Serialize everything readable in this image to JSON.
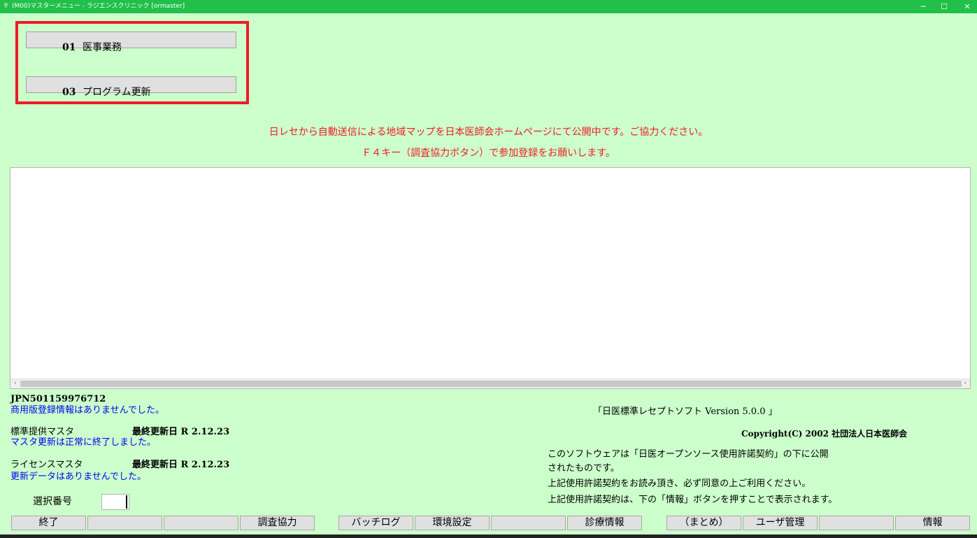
{
  "window": {
    "title": "(M00)マスターメニュー - ラジエンスクリニック [ormaster]",
    "app_icon": "app-icon",
    "min_glyph": "─",
    "max_glyph": "☐",
    "close_glyph": "✕"
  },
  "menu": {
    "items": [
      {
        "number": "01",
        "label": "医事業務"
      },
      {
        "number": "03",
        "label": "プログラム更新"
      }
    ]
  },
  "notice": {
    "line1": "日レセから自動送信による地域マップを日本医師会ホームページにて公開中です。ご協力ください。",
    "line2": "Ｆ４キー（調査協力ボタン）で参加登録をお願いします。"
  },
  "log": {
    "scroll_left": "‹",
    "scroll_right": "›"
  },
  "info": {
    "jpn_id": "JPN501159976712",
    "commercial_status": "商用版登録情報はありませんでした。",
    "std_master_label": "標準提供マスタ",
    "std_master_date_label": "最終更新日 R 2.12.23",
    "std_master_status": "マスタ更新は正常に終了しました。",
    "license_master_label": "ライセンスマスタ",
    "license_master_date_label": "最終更新日 R 2.12.23",
    "license_master_status": "更新データはありませんでした。"
  },
  "select": {
    "label": "選択番号",
    "value": ""
  },
  "about": {
    "version": "「日医標準レセプトソフト Version 5.0.0 」",
    "copyright": "Copyright(C) 2002 社団法人日本医師会",
    "license_1": "このソフトウェアは「日医オープンソース使用許諾契約」の下に公開",
    "license_2": "されたものです。",
    "license_3": "上記使用許諾契約をお読み頂き、必ず同意の上ご利用ください。",
    "license_4": "上記使用許諾契約は、下の「情報」ボタンを押すことで表示されます。"
  },
  "function_keys": [
    {
      "label": "終了"
    },
    {
      "label": ""
    },
    {
      "label": ""
    },
    {
      "label": "調査協力"
    },
    {
      "label": "バッチログ"
    },
    {
      "label": "環境設定"
    },
    {
      "label": ""
    },
    {
      "label": "診療情報"
    },
    {
      "label": "（まとめ）"
    },
    {
      "label": "ユーザ管理"
    },
    {
      "label": ""
    },
    {
      "label": "情報"
    }
  ],
  "colors": {
    "background": "#ccffcc",
    "titlebar": "#21c04a",
    "highlight_frame": "#ee1c25",
    "notice_text": "#ee1c25",
    "status_text": "#0000ee"
  }
}
